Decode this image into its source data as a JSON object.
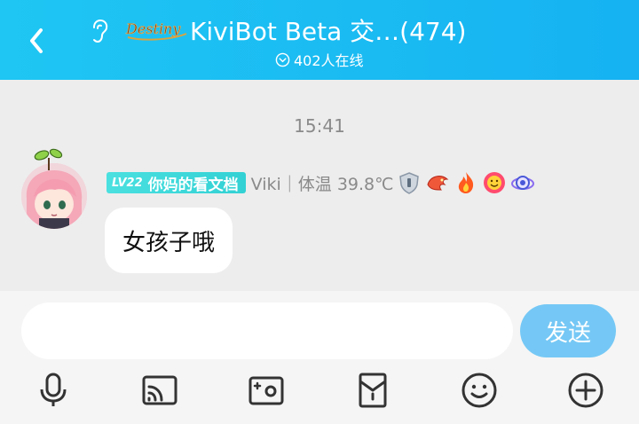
{
  "header": {
    "title": "KiviBot Beta 交…(474)",
    "online_count": "402人在线",
    "logo_text": "Destiny"
  },
  "chat": {
    "messages": [
      {
        "time": "15:41",
        "title_badge_level": "LV22",
        "title_badge_text": "你妈的看文档",
        "sender": "Viki｜体温 39.8℃",
        "text": "女孩子哦"
      }
    ]
  },
  "composer": {
    "placeholder": "",
    "send_label": "发送"
  },
  "toolbar": {
    "icons": [
      "microphone-icon",
      "screen-cast-icon",
      "photo-icon",
      "red-packet-icon",
      "emoji-icon",
      "plus-icon"
    ]
  },
  "colors": {
    "header_start": "#1fc6f3",
    "header_end": "#16b2f2",
    "badge": "#32d1d4",
    "send_button": "#75c8f5"
  }
}
